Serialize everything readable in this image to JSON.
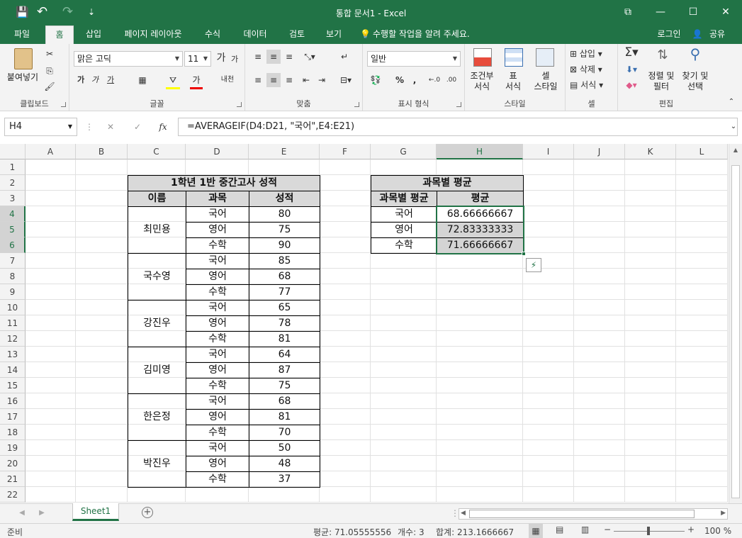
{
  "window": {
    "title": "통합 문서1 - Excel",
    "minimize": "—",
    "maximize": "☐",
    "close": "✕",
    "restore_icon": "⧉"
  },
  "qat": {
    "save": "💾",
    "undo": "↶",
    "redo": "↷",
    "customize": "⇣"
  },
  "tabs": {
    "file": "파일",
    "home": "홈",
    "insert": "삽입",
    "layout": "페이지 레이아웃",
    "formulas": "수식",
    "data": "데이터",
    "review": "검토",
    "view": "보기",
    "tellme": "수행할 작업을 알려 주세요.",
    "login": "로그인",
    "share": "공유"
  },
  "ribbon": {
    "paste": "붙여넣기",
    "clipboard": "클립보드",
    "font_name": "맑은 고딕",
    "font_size": "11",
    "font_group": "글꼴",
    "bold": "가",
    "italic": "가",
    "underline": "가",
    "grow": "가",
    "shrink": "가",
    "phonetic": "내천",
    "align_group": "맞춤",
    "number_format": "일반",
    "number_group": "표시 형식",
    "percent": "%",
    "comma": ",",
    "inc_dec": "←.0",
    "dec_dec": ".00",
    "cond_format": "조건부\n서식",
    "table_format": "표\n서식",
    "cell_style": "셀\n스타일",
    "style_group": "스타일",
    "insert": "삽입",
    "delete": "삭제",
    "format": "서식",
    "cells_group": "셀",
    "sort": "정렬 및\n필터",
    "find": "찾기 및\n선택",
    "edit_group": "편집"
  },
  "formula_bar": {
    "name_box": "H4",
    "cancel": "✕",
    "enter": "✓",
    "fx": "fx",
    "formula": "=AVERAGEIF(D4:D21, \"국어\",E4:E21)"
  },
  "columns": [
    "A",
    "B",
    "C",
    "D",
    "E",
    "F",
    "G",
    "H",
    "I",
    "J",
    "K",
    "L"
  ],
  "rows": [
    "1",
    "2",
    "3",
    "4",
    "5",
    "6",
    "7",
    "8",
    "9",
    "10",
    "11",
    "12",
    "13",
    "14",
    "15",
    "16",
    "17",
    "18",
    "19",
    "20",
    "21",
    "22"
  ],
  "table1": {
    "title": "1학년 1반 중간고사 성적",
    "headers": [
      "이름",
      "과목",
      "성적"
    ],
    "students": [
      "최민용",
      "국수영",
      "강진우",
      "김미영",
      "한은정",
      "박진우"
    ],
    "subjects": [
      "국어",
      "영어",
      "수학",
      "국어",
      "영어",
      "수학",
      "국어",
      "영어",
      "수학",
      "국어",
      "영어",
      "수학",
      "국어",
      "영어",
      "수학",
      "국어",
      "영어",
      "수학"
    ],
    "scores": [
      "80",
      "75",
      "90",
      "85",
      "68",
      "77",
      "65",
      "78",
      "81",
      "64",
      "87",
      "75",
      "68",
      "81",
      "70",
      "50",
      "48",
      "37"
    ]
  },
  "table2": {
    "title": "과목별 평균",
    "headers": [
      "과목별 평균",
      "평균"
    ],
    "subjects": [
      "국어",
      "영어",
      "수학"
    ],
    "averages": [
      "68.66666667",
      "72.83333333",
      "71.66666667"
    ]
  },
  "sheet_tabs": {
    "sheet1": "Sheet1",
    "add": "+"
  },
  "status": {
    "ready": "준비",
    "average": "평균: 71.05555556",
    "count": "개수: 3",
    "sum": "합계: 213.1666667",
    "zoom": "100 %",
    "zoom_minus": "−",
    "zoom_plus": "+"
  },
  "colors": {
    "excel_green": "#217346",
    "header_fill": "#d9d9d9"
  }
}
